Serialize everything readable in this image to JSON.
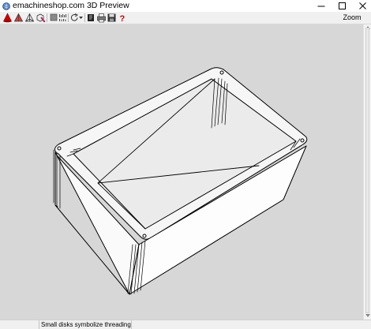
{
  "window": {
    "title": "emachineshop.com 3D Preview",
    "controls": [
      "minimize",
      "maximize",
      "close"
    ]
  },
  "toolbar": {
    "buttons": [
      "red-cone-icon",
      "solid-view-icon",
      "wireframe-view-icon",
      "cube-paint-icon",
      "gray-square-icon",
      "ruler-scale-icon",
      "rotate-icon",
      "dropdown-arrow-icon",
      "dark-square-icon",
      "print-icon",
      "save-icon",
      "help-icon"
    ],
    "zoom_label": "Zoom"
  },
  "colors": {
    "viewport_bg": "#d7d7d7",
    "accent_red": "#cc0000"
  },
  "status": {
    "message": "Small disks symbolize threading"
  }
}
